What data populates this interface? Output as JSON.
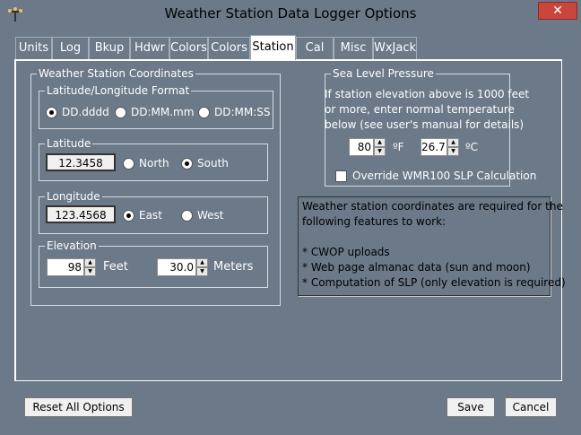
{
  "window": {
    "title": "Weather Station Data Logger Options",
    "close_label": "✕"
  },
  "tabs": [
    {
      "label": "Units"
    },
    {
      "label": "Log"
    },
    {
      "label": "Bkup"
    },
    {
      "label": "Hdwr"
    },
    {
      "label": "Colors"
    },
    {
      "label": "Colors"
    },
    {
      "label": "Station",
      "active": true
    },
    {
      "label": "Cal"
    },
    {
      "label": "Misc"
    },
    {
      "label": "WxJack"
    }
  ],
  "coords": {
    "group_label": "Weather Station Coordinates",
    "format": {
      "label": "Latitude/Longitude Format",
      "options": [
        "DD.dddd",
        "DD:MM.mm",
        "DD:MM:SS"
      ],
      "selected": "DD.dddd"
    },
    "latitude": {
      "label": "Latitude",
      "value": "12.3458",
      "north": "North",
      "south": "South",
      "selected": "South"
    },
    "longitude": {
      "label": "Longitude",
      "value": "123.4568",
      "east": "East",
      "west": "West",
      "selected": "East"
    },
    "elevation": {
      "label": "Elevation",
      "feet_value": "98",
      "feet_label": "Feet",
      "meters_value": "30.0",
      "meters_label": "Meters"
    }
  },
  "slp": {
    "label": "Sea Level Pressure",
    "line1": "If station elevation above is 1000 feet",
    "line2": "or more, enter normal temperature",
    "line3": "below (see user's manual for details)",
    "temp_f": "80",
    "unit_f": "ºF",
    "temp_c": "26.7",
    "unit_c": "ºC",
    "override_label": "Override WMR100 SLP Calculation"
  },
  "info": {
    "line1": "Weather station coordinates are required for the",
    "line2": "following features to work:",
    "line3": "* CWOP uploads",
    "line4": "* Web page almanac data (sun and moon)",
    "line5": "* Computation of SLP (only elevation is required)"
  },
  "buttons": {
    "reset": "Reset All Options",
    "save": "Save",
    "cancel": "Cancel"
  }
}
